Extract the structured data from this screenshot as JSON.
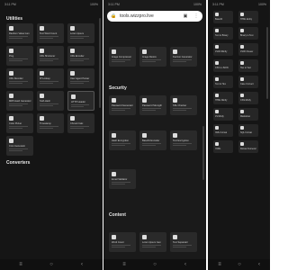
{
  "panel1": {
    "status": {
      "time": "3:11 PM",
      "right": "100%"
    },
    "sections": [
      "Utilities",
      "Converters"
    ],
    "tiles": [
      "Random Value Gen",
      "Text Word Count",
      "Lorem Ipsum",
      "Ping",
      "URL Shortener",
      "URL Encoder",
      "URL Decoder",
      "IP Lookup",
      "User Agent Parser",
      "MD5 Hash Generator",
      "SHA Hash",
      "HTTP Header",
      "Color Picker",
      "Timestamp",
      "Chmod Calc",
      "Cron Generator"
    ]
  },
  "panel2": {
    "status": {
      "time": "3:11 PM",
      "right": "100%"
    },
    "url": "tools.wizzpro.live",
    "sections": [
      "Security",
      "Content"
    ],
    "tiles": [
      "Image Compressor",
      "Image Resize",
      "Favicon Generator",
      "Password Generator",
      "Password Strength",
      "SSL Checker",
      "Hash Encryption",
      "Base64 Encoder",
      "Text Encryption",
      "Email Validator",
      "Word Count",
      "Lorem Ipsum Gen",
      "Text Separator"
    ]
  },
  "panel3": {
    "status": {
      "time": "3:11 PM",
      "right": "100%"
    },
    "tiles": [
      "Base64",
      "HTML Entity",
      "Text to Binary",
      "Binary to Text",
      "JSON Minify",
      "JSON Viewer",
      "CSV to JSON",
      "Hex to Text",
      "Text to Hex",
      "Case Convert",
      "HTML Minify",
      "CSS Minify",
      "JS Minify",
      "Markdown",
      "XML Format",
      "SQL Format",
      "YAML",
      "Roman Numeral"
    ]
  },
  "nav_icons": [
    "menu-icon",
    "home-icon",
    "back-icon"
  ],
  "colors": {
    "bg": "#151515",
    "tile": "#2a2a2a",
    "text": "#e8e8e8"
  }
}
